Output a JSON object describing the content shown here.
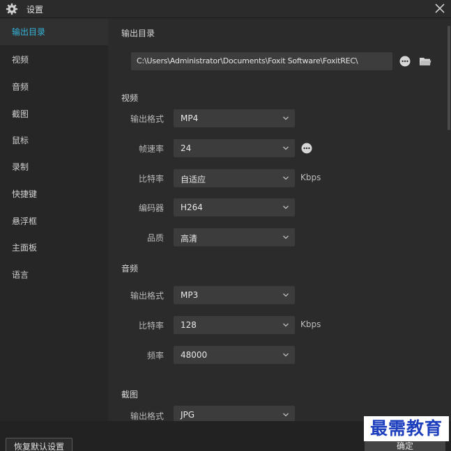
{
  "window": {
    "title": "设置",
    "settings_icon": "gear-icon",
    "close_icon": "close-icon"
  },
  "sidebar": {
    "items": [
      {
        "label": "输出目录",
        "active": true
      },
      {
        "label": "视频",
        "active": false
      },
      {
        "label": "音频",
        "active": false
      },
      {
        "label": "截图",
        "active": false
      },
      {
        "label": "鼠标",
        "active": false
      },
      {
        "label": "录制",
        "active": false
      },
      {
        "label": "快捷键",
        "active": false
      },
      {
        "label": "悬浮框",
        "active": false
      },
      {
        "label": "主面板",
        "active": false
      },
      {
        "label": "语言",
        "active": false
      }
    ]
  },
  "output_dir": {
    "title": "输出目录",
    "path": "C:\\Users\\Administrator\\Documents\\Foxit Software\\FoxitREC\\",
    "more_icon": "more-icon",
    "folder_icon": "folder-icon"
  },
  "video": {
    "title": "视频",
    "format": {
      "label": "输出格式",
      "value": "MP4"
    },
    "framerate": {
      "label": "帧速率",
      "value": "24",
      "more_icon": "more-icon"
    },
    "bitrate": {
      "label": "比特率",
      "value": "自适应",
      "unit": "Kbps"
    },
    "encoder": {
      "label": "编码器",
      "value": "H264"
    },
    "quality": {
      "label": "品质",
      "value": "高清"
    }
  },
  "audio": {
    "title": "音频",
    "format": {
      "label": "输出格式",
      "value": "MP3"
    },
    "bitrate": {
      "label": "比特率",
      "value": "128",
      "unit": "Kbps"
    },
    "frequency": {
      "label": "频率",
      "value": "48000"
    }
  },
  "screenshot": {
    "title": "截图",
    "format": {
      "label": "输出格式",
      "value": "JPG"
    }
  },
  "footer": {
    "reset_label": "恢复默认设置",
    "ok_label": "确定"
  },
  "watermark": "最需教育",
  "colors": {
    "accent": "#35b5d9",
    "background": "#2b2b2b",
    "sidebar": "#262626",
    "watermark": "#1d3fbd"
  }
}
